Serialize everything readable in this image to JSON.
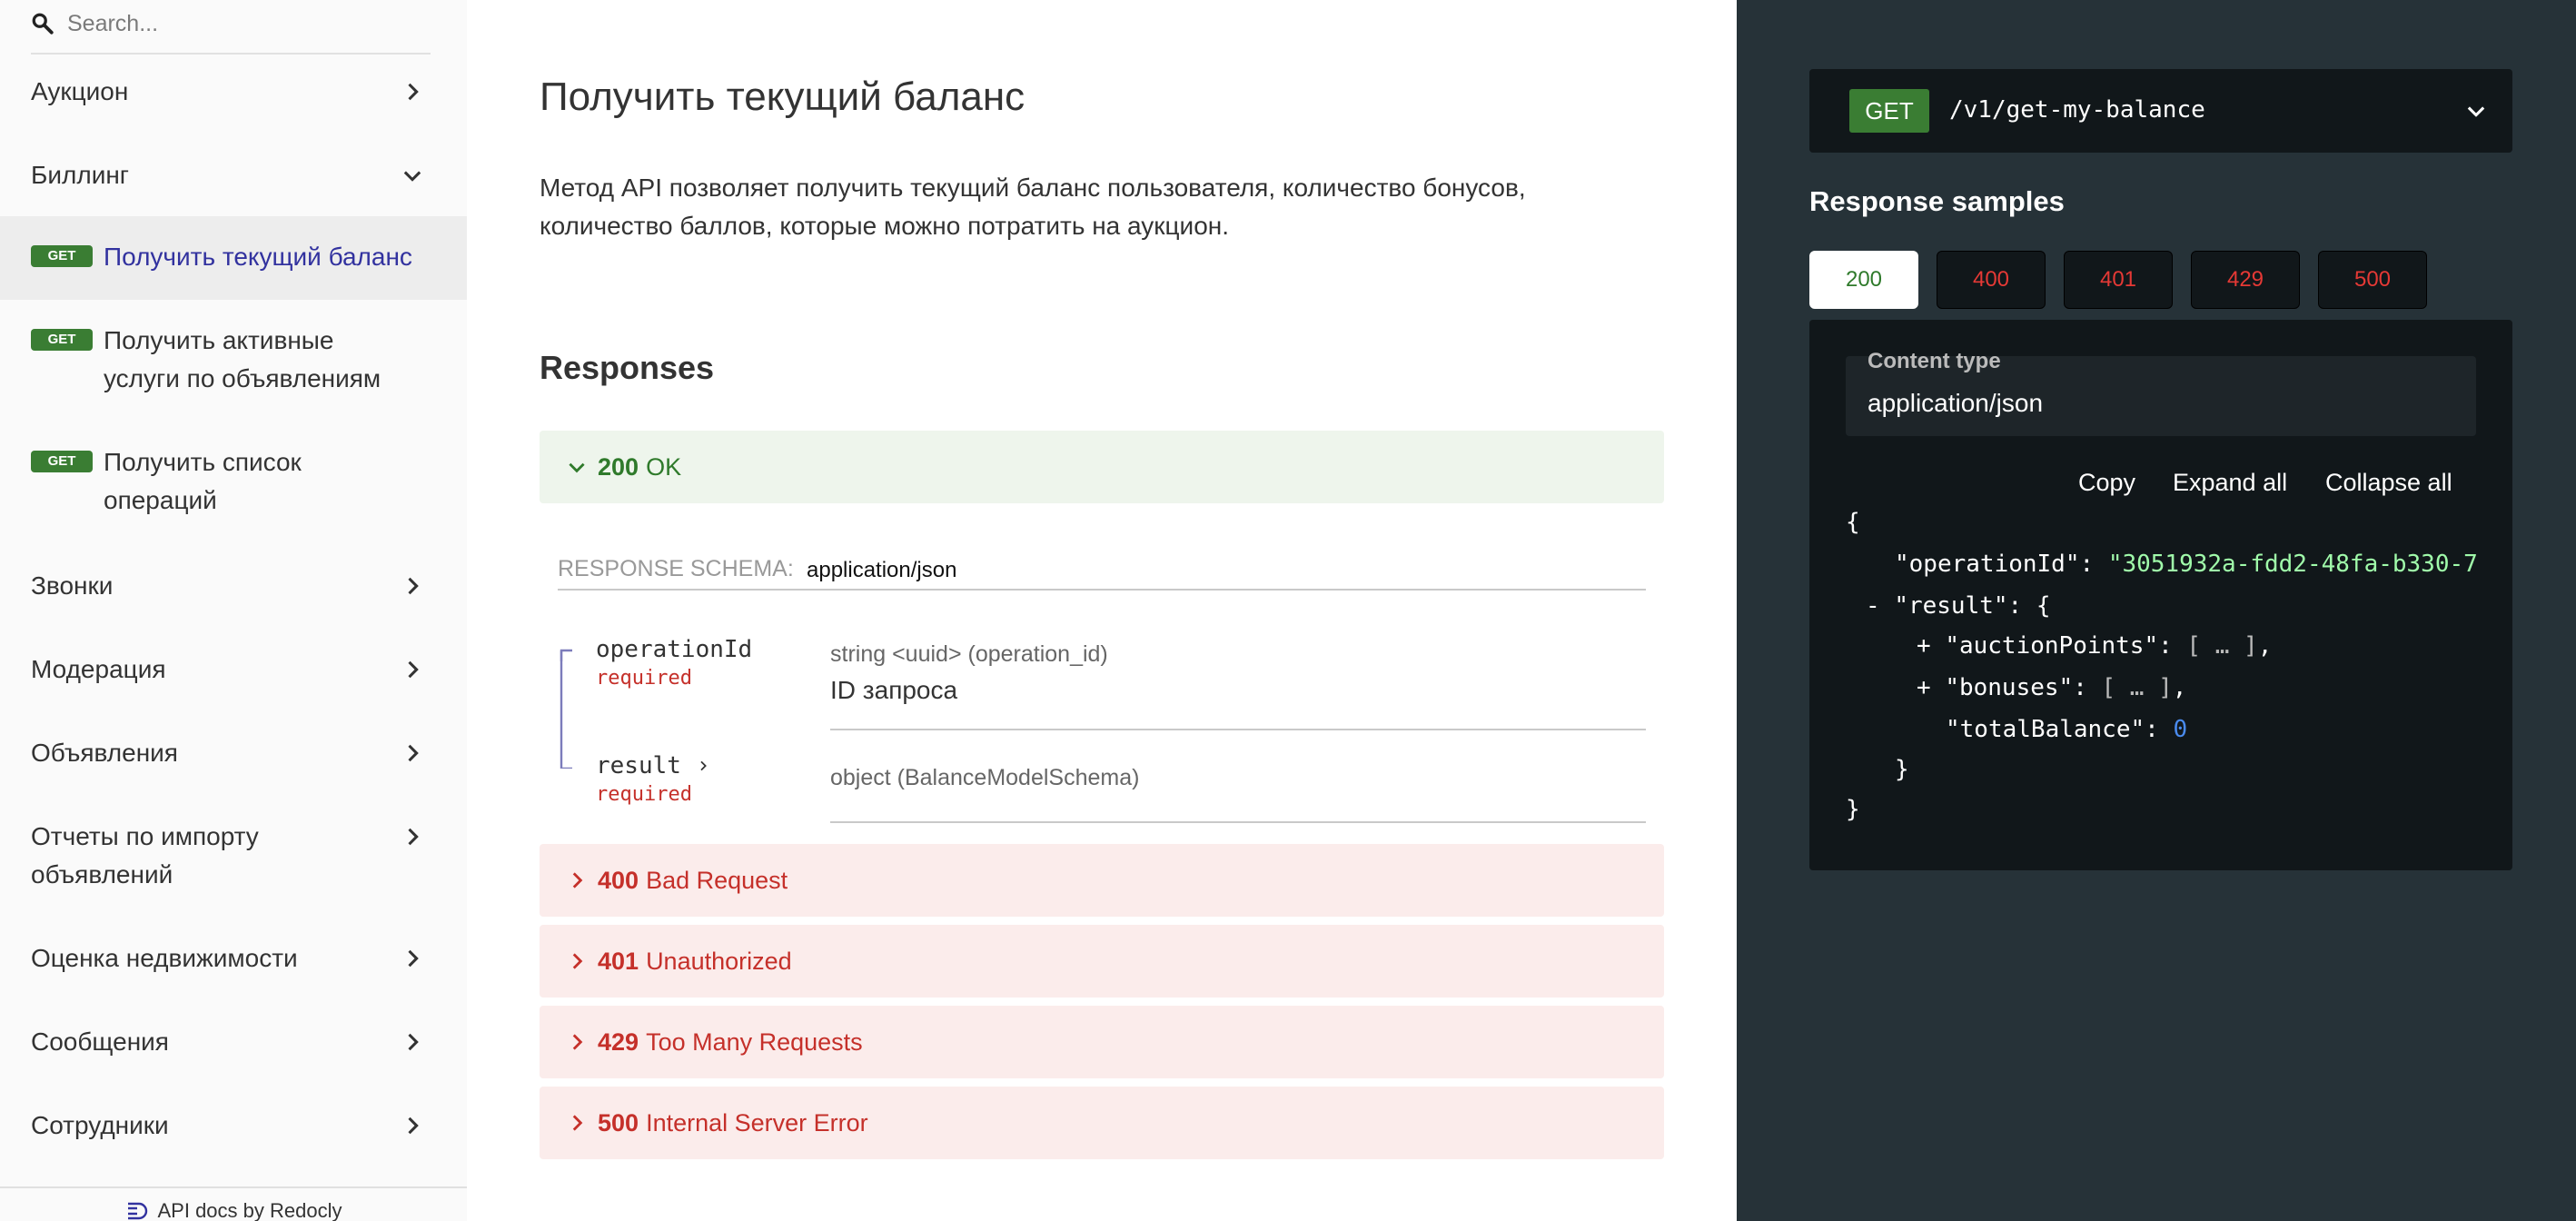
{
  "sidebar": {
    "search_placeholder": "Search...",
    "items": [
      {
        "label": "Аукцион"
      },
      {
        "label": "Биллинг"
      },
      {
        "label": "Звонки"
      },
      {
        "label": "Модерация"
      },
      {
        "label": "Объявления"
      },
      {
        "label_line1": "Отчеты по импорту",
        "label_line2": "объявлений"
      },
      {
        "label": "Оценка недвижимости"
      },
      {
        "label": "Сообщения"
      },
      {
        "label": "Сотрудники"
      }
    ],
    "sub_items": [
      {
        "badge": "GET",
        "label": "Получить текущий баланс"
      },
      {
        "badge": "GET",
        "label_line1": "Получить активные",
        "label_line2": "услуги по объявлениям"
      },
      {
        "badge": "GET",
        "label_line1": "Получить список",
        "label_line2": "операций"
      }
    ],
    "footer": "API docs by Redocly"
  },
  "main": {
    "title": "Получить текущий баланс",
    "description_line1": "Метод API позволяет получить текущий баланс пользователя, количество бонусов,",
    "description_line2": "количество баллов, которые можно потратить на аукцион.",
    "responses_title": "Responses",
    "responses": [
      {
        "code": "200",
        "text": "OK"
      },
      {
        "code": "400",
        "text": "Bad Request"
      },
      {
        "code": "401",
        "text": "Unauthorized"
      },
      {
        "code": "429",
        "text": "Too Many Requests"
      },
      {
        "code": "500",
        "text": "Internal Server Error"
      }
    ],
    "schema_label": "RESPONSE SCHEMA:",
    "schema_value": "application/json",
    "fields": [
      {
        "name": "operationId",
        "required": "required",
        "type": "string <uuid> (operation_id)",
        "description": "ID запроса"
      },
      {
        "name": "result",
        "required": "required",
        "type": "object (BalanceModelSchema)"
      }
    ]
  },
  "right": {
    "method": "GET",
    "path": "/v1/get-my-balance",
    "samples_title": "Response samples",
    "tabs": [
      "200",
      "400",
      "401",
      "429",
      "500"
    ],
    "content_type_label": "Content type",
    "content_type_value": "application/json",
    "actions": {
      "copy": "Copy",
      "expand": "Expand all",
      "collapse": "Collapse all"
    },
    "json": {
      "open": "{",
      "op_key": "\"operationId\": ",
      "op_val": "\"3051932a-fdd2-48fa-b330-7",
      "result_toggle": "- ",
      "result_key": "\"result\": {",
      "ap_toggle": "+ ",
      "ap_key": "\"auctionPoints\": ",
      "ap_val": "[ … ]",
      "ap_comma": ",",
      "bn_toggle": "+ ",
      "bn_key": "\"bonuses\": ",
      "bn_val": "[ … ]",
      "bn_comma": ",",
      "tb_key": "\"totalBalance\": ",
      "tb_val": "0",
      "inner_close": "}",
      "close": "}"
    },
    "colors": {
      "panel": "#263238",
      "code_bg": "#11171a",
      "get_badge": "#3a7d33",
      "string": "#a0fbaa",
      "number": "#4a8bee",
      "error": "#e53935"
    }
  }
}
